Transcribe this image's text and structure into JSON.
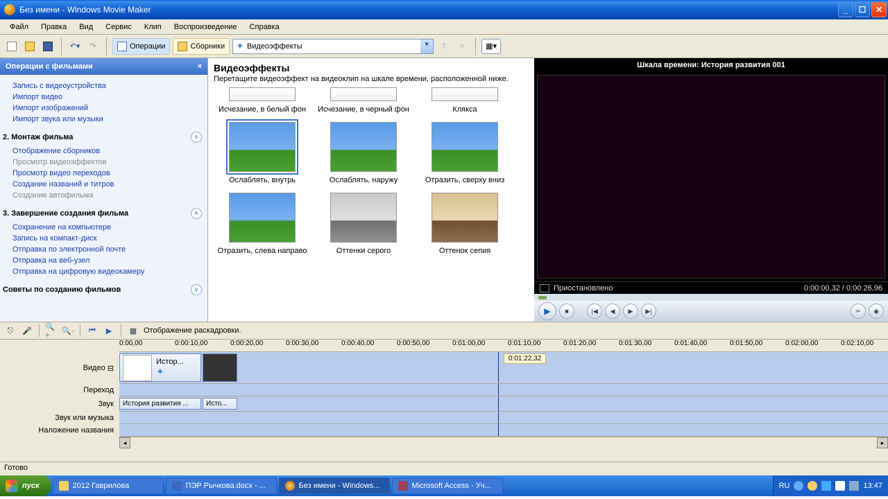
{
  "title": "Без имени - Windows Movie Maker",
  "menu": {
    "file": "Файл",
    "edit": "Правка",
    "view": "Вид",
    "service": "Сервис",
    "clip": "Клип",
    "play": "Воспроизведение",
    "help": "Справка"
  },
  "toolbar": {
    "ops": "Операции",
    "cols": "Сборники",
    "dropdown": "Видеоэффекты"
  },
  "tasks": {
    "header": "Операции с фильмами",
    "links1": [
      "Запись с видеоустройства",
      "Импорт видео",
      "Импорт изображений",
      "Импорт звука или музыки"
    ],
    "sec2": "2. Монтаж фильма",
    "links2": [
      "Отображение сборников",
      "Просмотр видеоэффектов",
      "Просмотр видео переходов",
      "Создание названий и титров",
      "Создание автофильма"
    ],
    "muted2": [
      1,
      4
    ],
    "sec3": "3. Завершение создания фильма",
    "links3": [
      "Сохранение на компьютере",
      "Запись на компакт-диск",
      "Отправка по электронной почте",
      "Отправка на веб-узел",
      "Отправка на цифровую видеокамеру"
    ],
    "sec4": "Советы по созданию фильмов"
  },
  "effects": {
    "title": "Видеоэффекты",
    "hint": "Перетащите видеоэффект на видеоклип на шкале времени, расположенной ниже.",
    "row0": [
      "Исчезание, в белый фон",
      "Исчезание, в черный фон",
      "Клякса"
    ],
    "row1": [
      "Ослаблять, внутрь",
      "Ослаблять, наружу",
      "Отразить, сверху вниз"
    ],
    "row2": [
      "Отразить, слева направо",
      "Оттенки серого",
      "Оттенок сепия"
    ]
  },
  "preview": {
    "title": "Шкала времени: История развития 001",
    "status": "Приостановлено",
    "time": "0:00:00,32 / 0:00:26,96"
  },
  "timeline": {
    "storyboard": "Отображение раскадровки.",
    "ticks": [
      "0:00,00",
      "0:00:10,00",
      "0:00:20,00",
      "0:00:30,00",
      "0:00:40,00",
      "0:00:50,00",
      "0:01:00,00",
      "0:01:10,00",
      "0:01:20,00",
      "0:01:30,00",
      "0:01:40,00",
      "0:01:50,00",
      "0:02:00,00",
      "0:02:10,00"
    ],
    "tracks": {
      "video": "Видео",
      "trans": "Переход",
      "audio": "Звук",
      "music": "Звук или музыка",
      "title": "Наложение названия"
    },
    "clip1": "Истор...",
    "audio1": "История развития ...",
    "audio2": "Исто...",
    "marker": "0:01:22,32"
  },
  "status": "Готово",
  "taskbar": {
    "start": "пуск",
    "btns": [
      "2012 Гаврилова",
      "ПЭР Рычкова.docx - ...",
      "Без имени - Windows...",
      "Microsoft Access - Уч..."
    ],
    "lang": "RU",
    "clock": "13:47"
  }
}
